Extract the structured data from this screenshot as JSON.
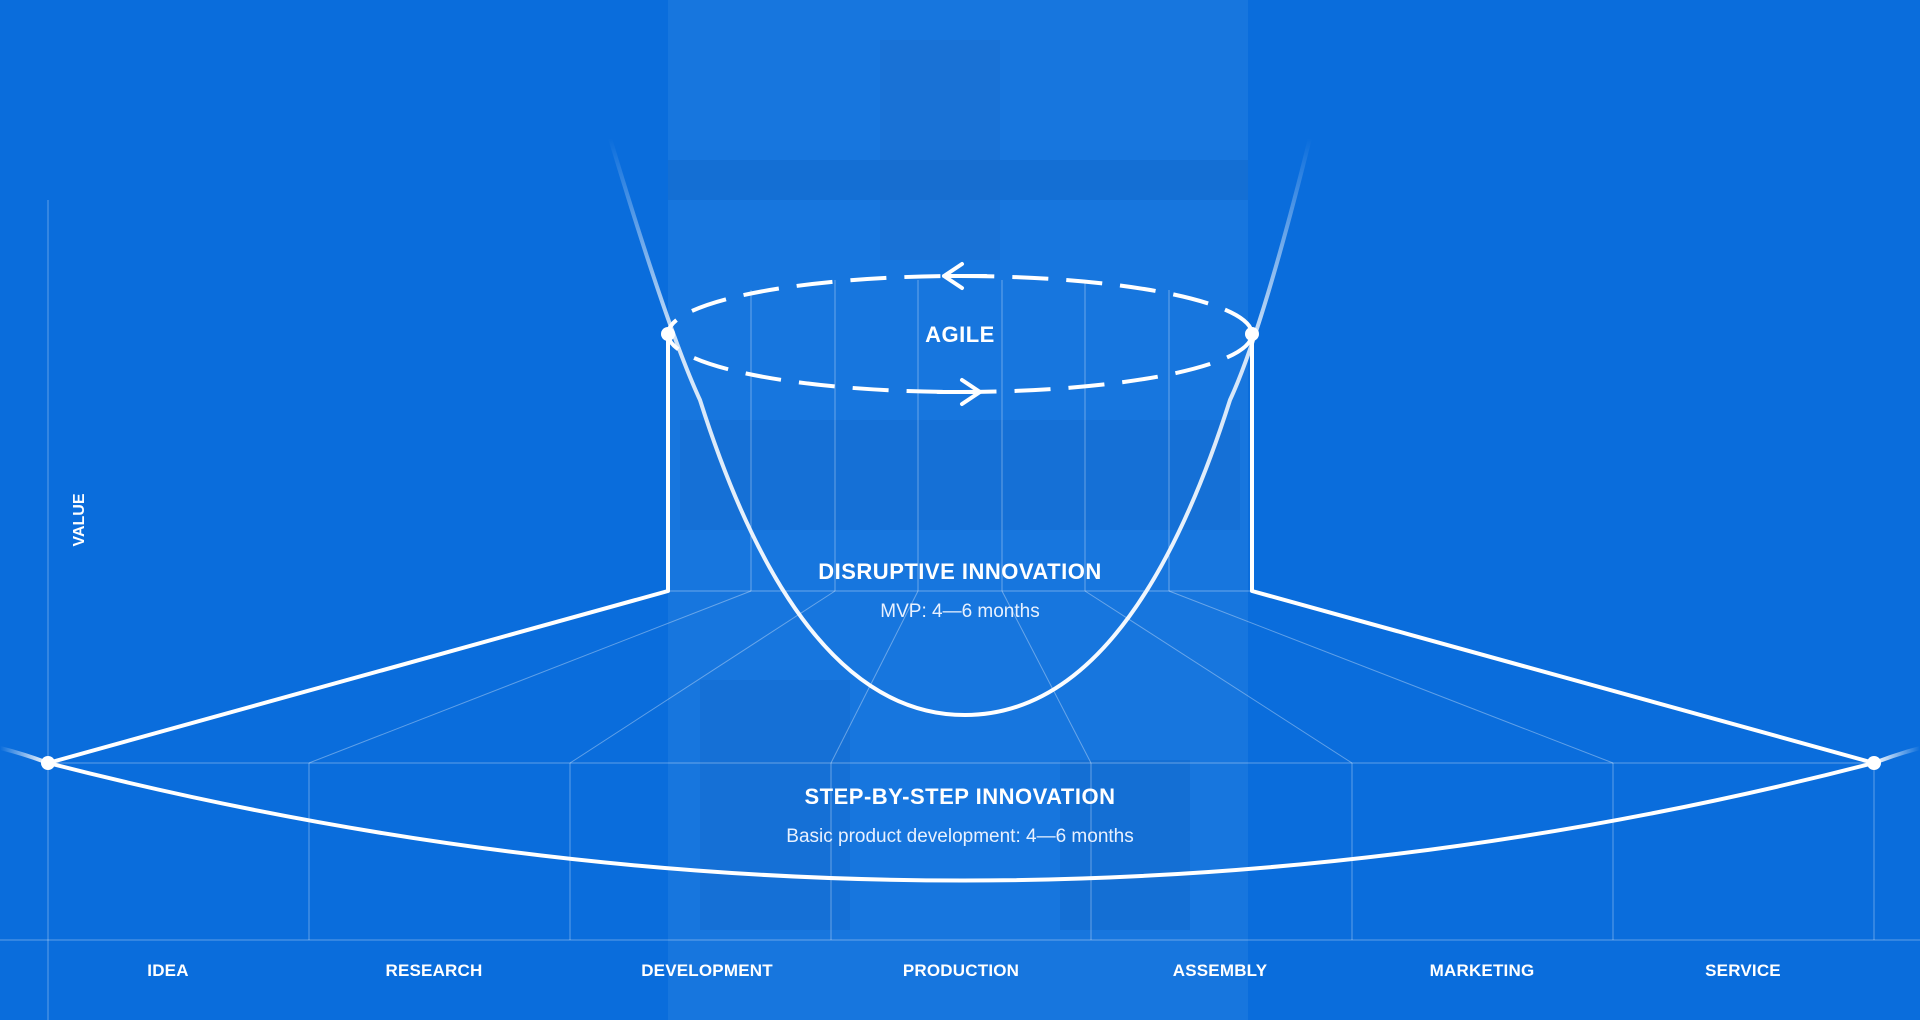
{
  "axis": {
    "y_label": "VALUE"
  },
  "agile": {
    "label": "AGILE"
  },
  "disruptive": {
    "title": "DISRUPTIVE INNOVATION",
    "subtitle": "MVP: 4—6 months"
  },
  "step": {
    "title": "STEP-BY-STEP INNOVATION",
    "subtitle": "Basic product development: 4—6 months"
  },
  "stages": [
    "IDEA",
    "RESEARCH",
    "DEVELOPMENT",
    "PRODUCTION",
    "ASSEMBLY",
    "MARKETING",
    "SERVICE"
  ],
  "colors": {
    "background": "#0a6ddc",
    "photo_band": "#1a78de",
    "line": "#ffffff"
  }
}
